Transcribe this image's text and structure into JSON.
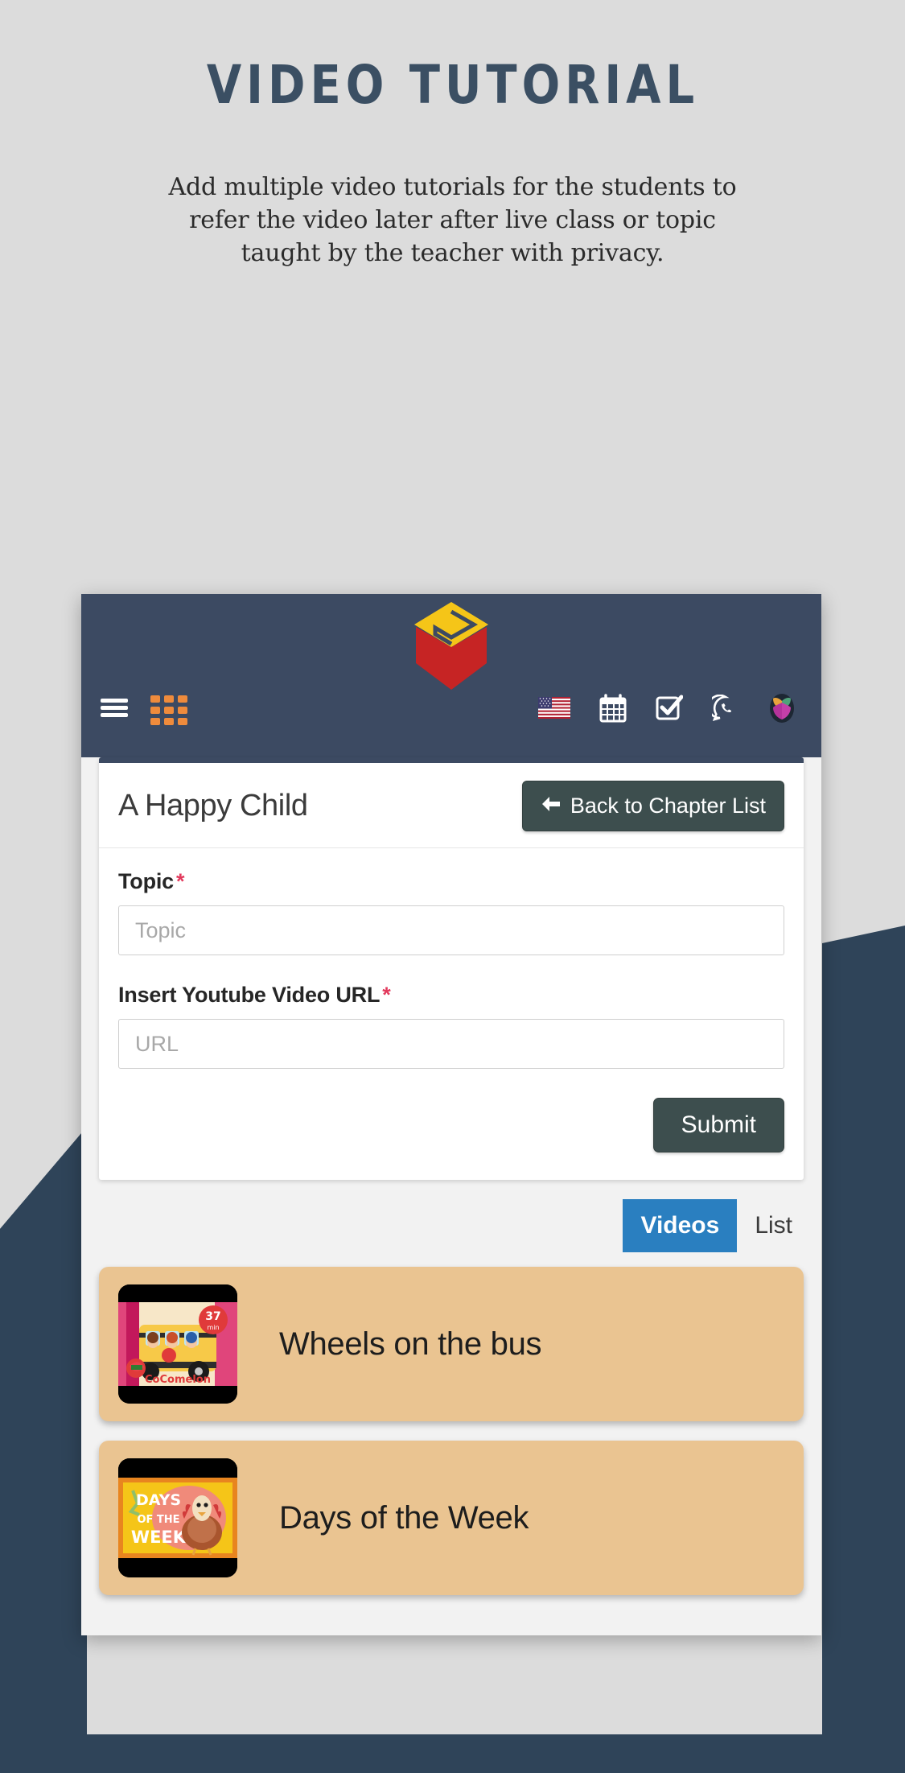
{
  "hero": {
    "title": "VIDEO TUTORIAL",
    "description": "Add multiple video tutorials for the students to refer the video later after live class or topic taught by the teacher with privacy."
  },
  "colors": {
    "page_bg": "#dcdcdc",
    "navy": "#2f4459",
    "navbar": "#3c4a62",
    "accent_orange": "#ef8b3c",
    "button_dark": "#3d4e4e",
    "tab_active_blue": "#2a7fc0",
    "required_red": "#e2395c",
    "card_item_tan": "#eac491",
    "logo_yellow": "#f5c518",
    "logo_red": "#c62424"
  },
  "app": {
    "navbar": {
      "logo_name": "app-logo-box",
      "menu_icon": "hamburger-icon",
      "apps_icon": "grid-apps-icon",
      "right_icons": [
        {
          "name": "us-flag-icon",
          "label": "English (US)"
        },
        {
          "name": "calendar-icon",
          "label": "Calendar"
        },
        {
          "name": "task-checkbox-icon",
          "label": "Tasks"
        },
        {
          "name": "whatsapp-icon",
          "label": "WhatsApp"
        },
        {
          "name": "profile-book-icon",
          "label": "Profile"
        }
      ]
    },
    "card": {
      "title": "A Happy Child",
      "back_button": "Back to Chapter List",
      "back_icon": "arrow-left-icon",
      "fields": [
        {
          "label": "Topic",
          "required_mark": "*",
          "placeholder": "Topic",
          "value": ""
        },
        {
          "label": "Insert Youtube Video URL",
          "required_mark": "*",
          "placeholder": "URL",
          "value": ""
        }
      ],
      "submit_label": "Submit"
    },
    "tabs": [
      {
        "label": "Videos",
        "active": true
      },
      {
        "label": "List",
        "active": false
      }
    ],
    "videos": [
      {
        "title": "Wheels on the bus",
        "thumb": "cocomelon-bus-thumb",
        "badge": "37 min"
      },
      {
        "title": "Days of the Week",
        "thumb": "days-of-the-week-thumb",
        "badge": ""
      }
    ]
  }
}
